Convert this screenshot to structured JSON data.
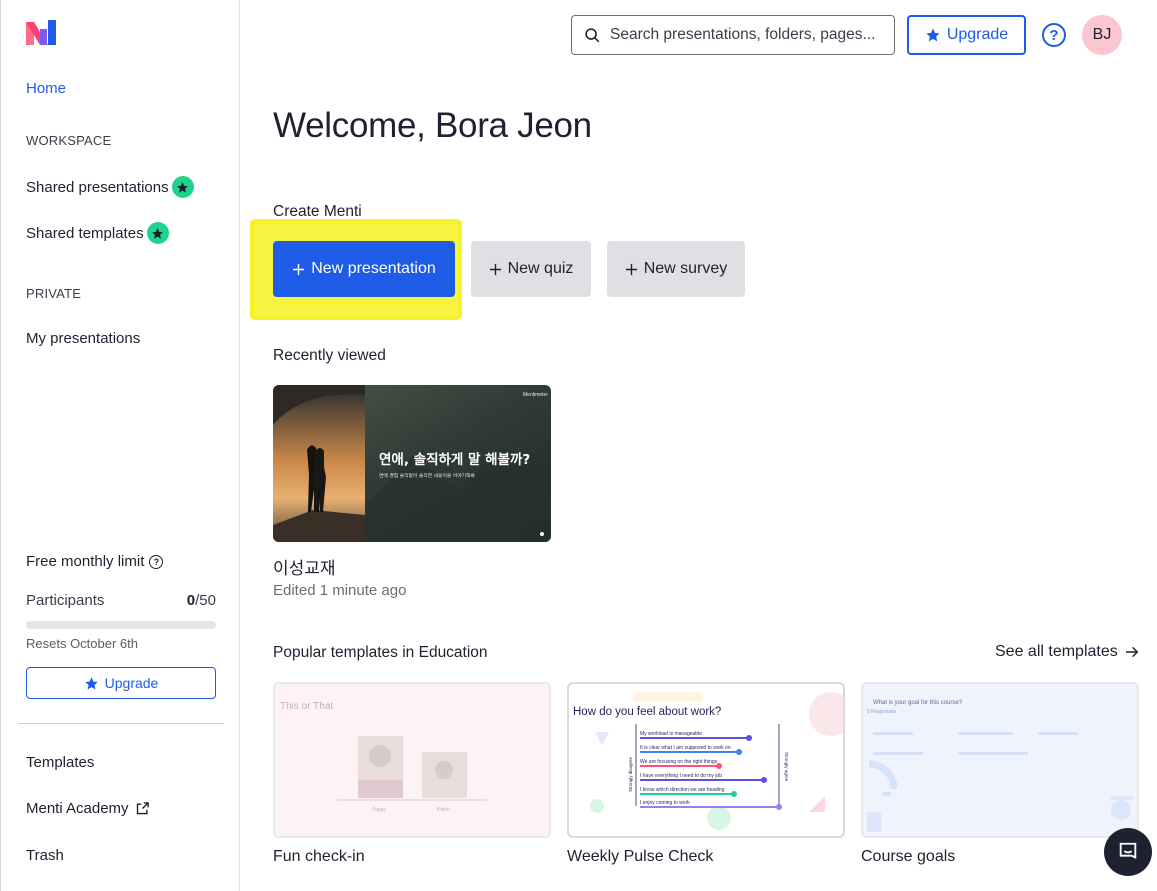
{
  "sidebar": {
    "home": "Home",
    "workspace_heading": "WORKSPACE",
    "shared_presentations": "Shared presentations",
    "shared_templates": "Shared templates",
    "private_heading": "PRIVATE",
    "my_presentations": "My presentations",
    "limit": {
      "title": "Free monthly limit",
      "participants_label": "Participants",
      "used": "0",
      "total": "/50",
      "progress_fraction": 0,
      "resets": "Resets October 6th",
      "upgrade_label": "Upgrade"
    },
    "templates": "Templates",
    "academy": "Menti Academy",
    "trash": "Trash"
  },
  "header": {
    "search_placeholder": "Search presentations, folders, pages...",
    "upgrade_label": "Upgrade",
    "help_symbol": "?",
    "avatar_initials": "BJ"
  },
  "main": {
    "welcome": "Welcome, Bora Jeon",
    "create_heading": "Create Menti",
    "create_buttons": {
      "presentation": "New presentation",
      "quiz": "New quiz",
      "survey": "New survey"
    },
    "recently_viewed_heading": "Recently viewed",
    "recent": {
      "thumb_title": "연애, 솔직하게 말 해볼까?",
      "thumb_subtitle": "연애 경험 솔직없이 솔직한 내용이을 이야기해봐",
      "thumb_brand": "Mentimeter",
      "title": "이성교재",
      "edited": "Edited 1 minute ago"
    },
    "popular_heading": "Popular templates in Education",
    "see_all": "See all templates",
    "templates": [
      {
        "name": "Fun check-in",
        "thumb_title": "This or That",
        "options": [
          "Puppy",
          "Kitten"
        ]
      },
      {
        "name": "Weekly Pulse Check",
        "thumb_title": "How do you feel about work?",
        "statements": [
          "My workload is manageable",
          "It is clear what I am supposed to work on",
          "We are focusing on the right things",
          "I have everything I need to do my job",
          "I know which direction we are heading",
          "I enjoy coming to work"
        ],
        "scale_left": "Strongly disagree",
        "scale_right": "Strongly agree"
      },
      {
        "name": "Course goals",
        "thumb_title": "What is your goal for this course?",
        "thumb_subtitle": "5 Responses"
      }
    ]
  },
  "colors": {
    "accent": "#1e5be6",
    "badge_green": "#1fd28d",
    "highlight_yellow": "#f6f22c",
    "avatar_pink": "#fbc6d0"
  }
}
